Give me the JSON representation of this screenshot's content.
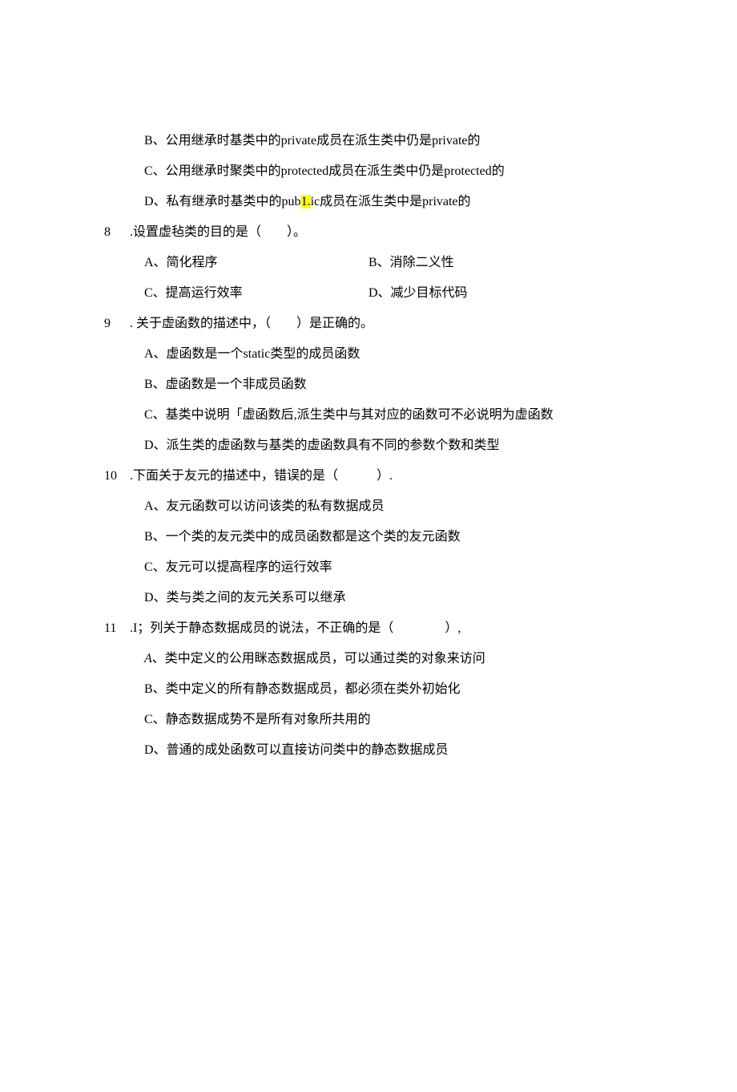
{
  "lines": {
    "opt_b_prev": "B、公用继承时基类中的private成员在派生类中仍是private的",
    "opt_c_prev": "C、公用继承时聚类中的protected成员在派生类中仍是protected的",
    "opt_d_prev_pre": "D、私有继承时基类中的pub",
    "opt_d_prev_hl": "1.",
    "opt_d_prev_post": "ic成员在派生类中是private的",
    "q8_num": "8",
    "q8_text": "  .设置虚毡类的目的是（  ）。",
    "q8_a": "A、简化程序",
    "q8_b": "B、消除二义性",
    "q8_c": "C、提高运行效率",
    "q8_d": "D、减少目标代码",
    "q9_num": "9",
    "q9_text": "  . 关于虚函数的描述中，（  ）是正确的。",
    "q9_a": "A、虚函数是一个static类型的成员函数",
    "q9_b": "B、虚函数是一个非成员函数",
    "q9_c": "C、基类中说明「虚函数后,派生类中与其对应的函数可不必说明为虚函数",
    "q9_d": "D、派生类的虚函数与基类的虚函数具有不同的参数个数和类型",
    "q10_num": "10",
    "q10_text": "  .下面关于友元的描述中，错误的是（   ）.",
    "q10_a": "A、友元函数可以访问该类的私有数据成员",
    "q10_b": "B、一个类的友元类中的成员函数都是这个类的友元函数",
    "q10_c": "C、友元可以提高程序的运行效率",
    "q10_d": "D、类与类之间的友元关系可以继承",
    "q11_num": "11",
    "q11_text": "  .I；列关于静态数据成员的说法，不正确的是（    ）,",
    "q11_a": "A、类中定义的公用眯态数据成员，可以通过类的对象来访问",
    "q11_b": "B、类中定义的所有静态数据成员，都必须在类外初始化",
    "q11_c": "C、静态数据成势不是所有对象所共用的",
    "q11_d": "D、普通的成处函数可以直接访问类中的静态数据成员"
  }
}
